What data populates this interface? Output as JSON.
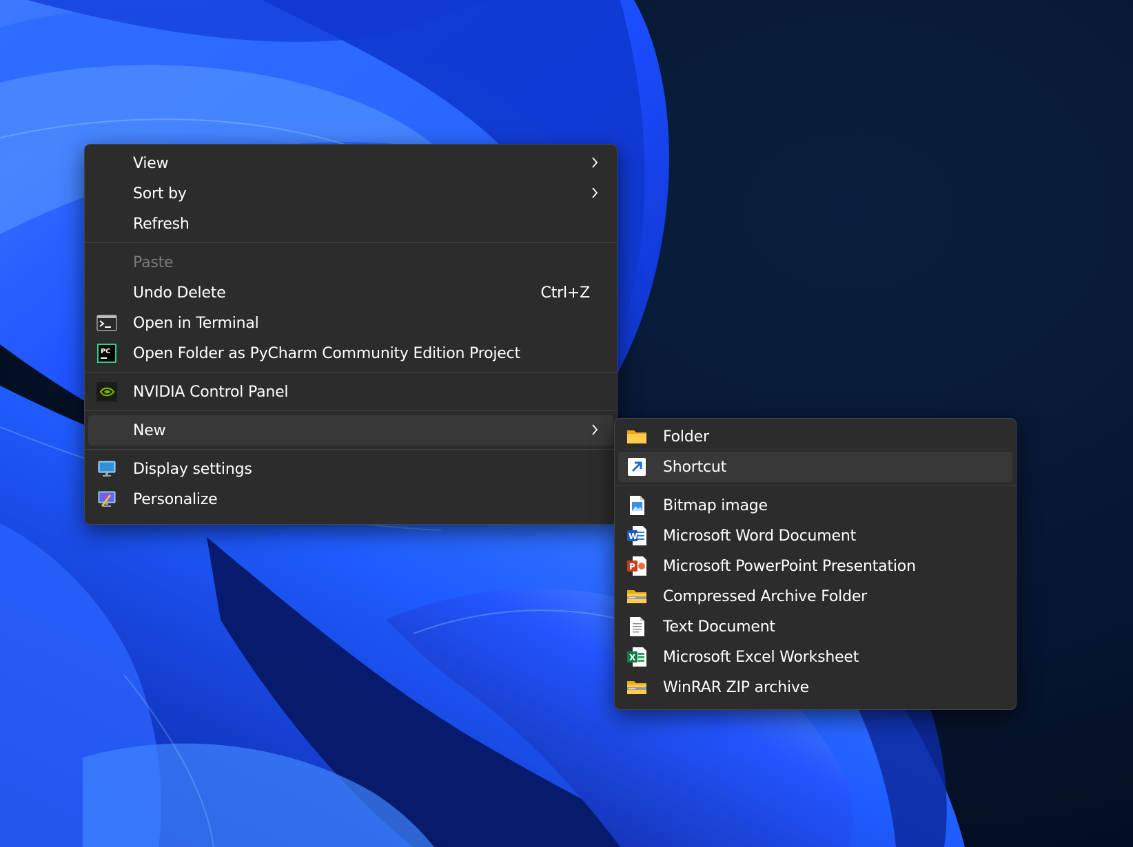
{
  "context_menu": {
    "items": [
      {
        "label": "View"
      },
      {
        "label": "Sort by"
      },
      {
        "label": "Refresh"
      },
      {
        "label": "Paste"
      },
      {
        "label": "Undo Delete",
        "shortcut": "Ctrl+Z"
      },
      {
        "label": "Open in Terminal",
        "icon": "terminal-icon"
      },
      {
        "label": "Open Folder as PyCharm Community Edition Project",
        "icon": "pycharm-icon",
        "icon_text": "PC"
      },
      {
        "label": "NVIDIA Control Panel",
        "icon": "nvidia-icon"
      },
      {
        "label": "New"
      },
      {
        "label": "Display settings",
        "icon": "display-settings-icon"
      },
      {
        "label": "Personalize",
        "icon": "personalize-icon"
      }
    ]
  },
  "new_submenu": {
    "items": [
      {
        "label": "Folder",
        "icon": "folder-icon"
      },
      {
        "label": "Shortcut",
        "icon": "shortcut-icon"
      },
      {
        "label": "Bitmap image",
        "icon": "bitmap-icon"
      },
      {
        "label": "Microsoft Word Document",
        "icon": "word-icon",
        "icon_text": "W"
      },
      {
        "label": "Microsoft PowerPoint Presentation",
        "icon": "powerpoint-icon",
        "icon_text": "P"
      },
      {
        "label": "Compressed Archive Folder",
        "icon": "archive-folder-icon"
      },
      {
        "label": "Text Document",
        "icon": "text-document-icon"
      },
      {
        "label": "Microsoft Excel Worksheet",
        "icon": "excel-icon",
        "icon_text": "X"
      },
      {
        "label": "WinRAR ZIP archive",
        "icon": "winrar-zip-icon"
      }
    ]
  },
  "colors": {
    "menu_background": "#2c2c2c",
    "hover_background": "#383838",
    "text": "#ffffff",
    "disabled_text": "#7a7a7a",
    "wallpaper_blue": "#1a4fff"
  }
}
